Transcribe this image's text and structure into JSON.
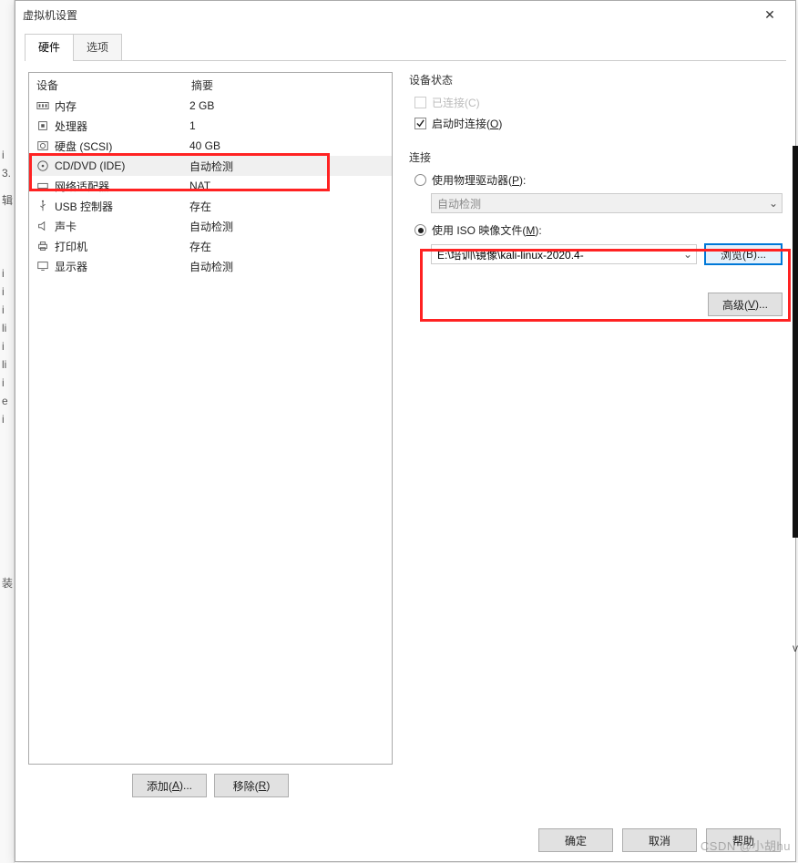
{
  "window": {
    "title": "虚拟机设置"
  },
  "tabs": [
    "硬件",
    "选项"
  ],
  "device_list": {
    "headers": [
      "设备",
      "摘要"
    ],
    "rows": [
      {
        "device": "内存",
        "summary": "2 GB"
      },
      {
        "device": "处理器",
        "summary": "1"
      },
      {
        "device": "硬盘 (SCSI)",
        "summary": "40 GB"
      },
      {
        "device": "CD/DVD (IDE)",
        "summary": "自动检测"
      },
      {
        "device": "网络适配器",
        "summary": "NAT"
      },
      {
        "device": "USB 控制器",
        "summary": "存在"
      },
      {
        "device": "声卡",
        "summary": "自动检测"
      },
      {
        "device": "打印机",
        "summary": "存在"
      },
      {
        "device": "显示器",
        "summary": "自动检测"
      }
    ]
  },
  "right": {
    "status": {
      "title": "设备状态",
      "connected_pre": "已连接(",
      "connected_key": "C",
      "connected_post": ")",
      "poweron_pre": "启动时连接(",
      "poweron_key": "O",
      "poweron_post": ")"
    },
    "connection": {
      "title": "连接",
      "physical_pre": "使用物理驱动器(",
      "physical_key": "P",
      "physical_post": "):",
      "physical_value": "自动检测",
      "iso_pre": "使用 ISO 映像文件(",
      "iso_key": "M",
      "iso_post": "):",
      "iso_value": "E:\\培训\\镜像\\kali-linux-2020.4-"
    }
  },
  "buttons": {
    "add_pre": "添加(",
    "add_key": "A",
    "add_post": ")...",
    "remove_pre": "移除(",
    "remove_key": "R",
    "remove_post": ")",
    "browse_pre": "浏览(",
    "browse_key": "B",
    "browse_post": ")...",
    "advanced_pre": "高级(",
    "advanced_key": "V",
    "advanced_post": ")...",
    "ok": "确定",
    "cancel": "取消",
    "help": "帮助"
  },
  "watermark": "CSDN @小胡hu"
}
